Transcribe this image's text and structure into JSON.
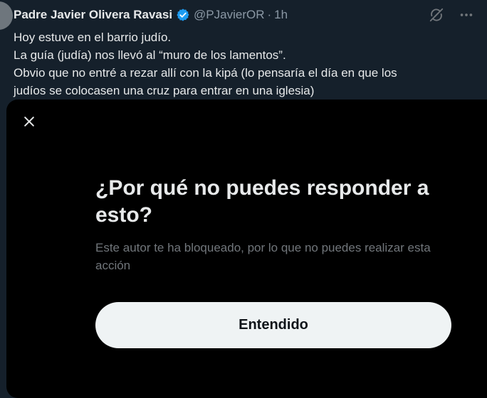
{
  "tweet": {
    "author_name": "Padre Javier Olivera Ravasi",
    "handle": "@PJavierOR",
    "separator": "·",
    "time": "1h",
    "lines": [
      "Hoy estuve en el barrio judío.",
      "La guía (judía) nos llevó al “muro de los lamentos”.",
      "Obvio que no entré a rezar allí con la kipá (lo pensaría el día en que los",
      "judíos se colocasen una cruz para entrar en una iglesia)"
    ],
    "icons": [
      "verified-badge-icon",
      "grok-icon",
      "more-icon"
    ]
  },
  "modal": {
    "close_icon": "close-icon",
    "title": "¿Por qué no puedes responder a esto?",
    "description": "Este autor te ha bloqueado, por lo que no puedes realizar esta acción",
    "button_label": "Entendido"
  },
  "colors": {
    "page_background": "#15202b",
    "modal_background": "#000000",
    "primary_text": "#e7e9ea",
    "secondary_text": "#8b98a5",
    "modal_secondary_text": "#71767b",
    "verified_blue": "#1d9bf0",
    "button_background": "#eff3f4",
    "button_text": "#0f1419"
  }
}
